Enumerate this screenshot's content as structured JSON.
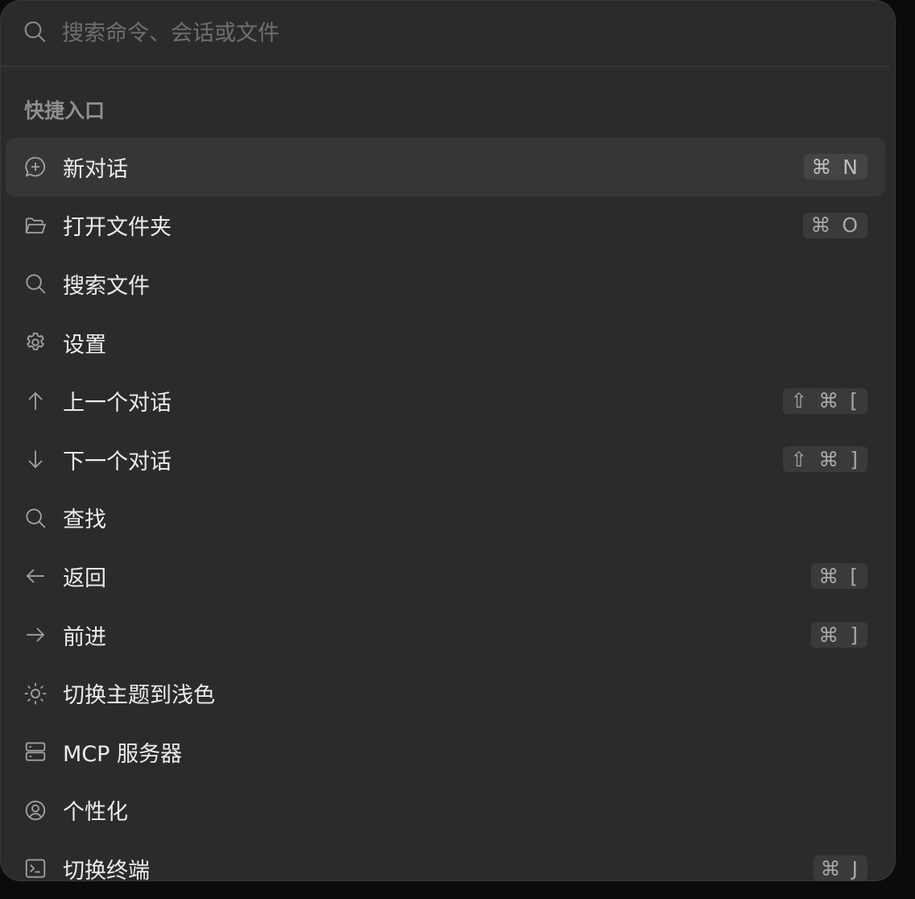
{
  "search": {
    "placeholder": "搜索命令、会话或文件",
    "icon": "search-icon"
  },
  "section": {
    "title": "快捷入口"
  },
  "items": [
    {
      "label": "新对话",
      "icon": "new-chat-icon",
      "shortcut": "⌘ N",
      "active": true
    },
    {
      "label": "打开文件夹",
      "icon": "folder-open-icon",
      "shortcut": "⌘ O"
    },
    {
      "label": "搜索文件",
      "icon": "search-icon",
      "shortcut": ""
    },
    {
      "label": "设置",
      "icon": "gear-icon",
      "shortcut": ""
    },
    {
      "label": "上一个对话",
      "icon": "arrow-up-icon",
      "shortcut": "⇧ ⌘ ["
    },
    {
      "label": "下一个对话",
      "icon": "arrow-down-icon",
      "shortcut": "⇧ ⌘ ]"
    },
    {
      "label": "查找",
      "icon": "search-icon",
      "shortcut": ""
    },
    {
      "label": "返回",
      "icon": "arrow-left-icon",
      "shortcut": "⌘ ["
    },
    {
      "label": "前进",
      "icon": "arrow-right-icon",
      "shortcut": "⌘ ]"
    },
    {
      "label": "切换主题到浅色",
      "icon": "sun-icon",
      "shortcut": ""
    },
    {
      "label": "MCP 服务器",
      "icon": "server-icon",
      "shortcut": ""
    },
    {
      "label": "个性化",
      "icon": "user-circle-icon",
      "shortcut": ""
    },
    {
      "label": "切换终端",
      "icon": "terminal-icon",
      "shortcut": "⌘ J"
    }
  ],
  "colors": {
    "background": "#2b2b2b",
    "active_row": "#363636",
    "text": "#ececec",
    "muted": "#8e8e8e"
  }
}
